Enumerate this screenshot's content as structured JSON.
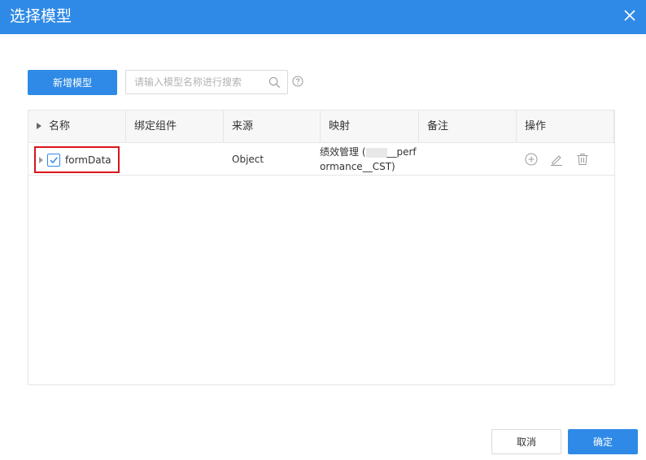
{
  "dialog": {
    "title": "选择模型"
  },
  "toolbar": {
    "new_button_label": "新增模型",
    "search_placeholder": "请输入模型名称进行搜索"
  },
  "table": {
    "columns": [
      "名称",
      "绑定组件",
      "来源",
      "映射",
      "备注",
      "操作"
    ],
    "rows": [
      {
        "name": "formData",
        "checked": true,
        "bound_component": "",
        "source": "Object",
        "mapping_prefix": "绩效管理 (",
        "mapping_suffix": "__perf",
        "mapping_line2": "ormance__CST)",
        "remark": ""
      }
    ]
  },
  "footer": {
    "cancel_label": "取消",
    "confirm_label": "确定"
  },
  "colors": {
    "primary": "#2e8ae6",
    "highlight": "#d9141a"
  },
  "icons": [
    "close-icon",
    "search-icon",
    "help-icon",
    "add-icon",
    "edit-icon",
    "delete-icon",
    "checkbox-checked-icon"
  ]
}
